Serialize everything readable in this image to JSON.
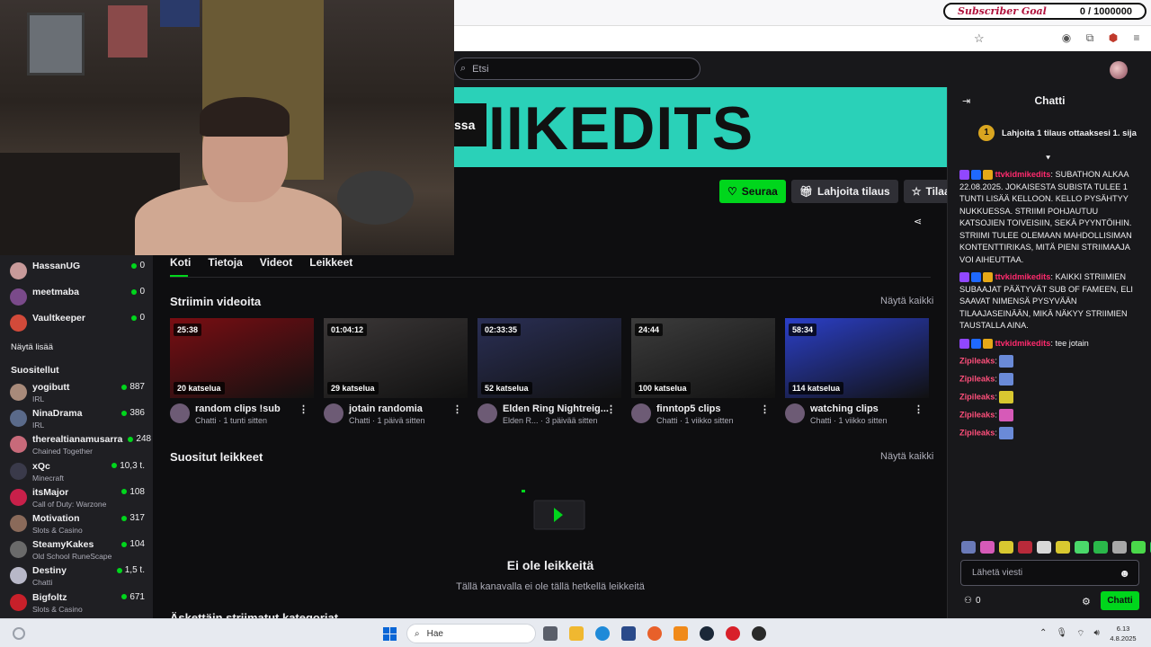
{
  "overlay": {
    "subscriber_goal_label": "Subscriber Goal",
    "subscriber_goal_value": "0 / 1000000"
  },
  "topbar": {
    "search_placeholder": "Etsi"
  },
  "banner": {
    "tag_text": "ssa",
    "word": "IIKEDITS"
  },
  "channel_actions": {
    "follow_label": "Seuraa",
    "gift_label": "Lahjoita tilaus",
    "subscribe_label": "Tilaa"
  },
  "tabs": [
    "Koti",
    "Tietoja",
    "Videot",
    "Leikkeet"
  ],
  "sections": {
    "stream_videos_title": "Striimin videoita",
    "see_all": "Näytä kaikki",
    "popular_clips_title": "Suositut leikkeet",
    "see_all_2": "Näytä kaikki",
    "recent_categories_title": "Äskettäin striimatut kategoriat"
  },
  "videos": [
    {
      "duration": "25:38",
      "views": "20 katselua",
      "title": "random clips !sub",
      "sub": "Chatti · 1 tunti sitten",
      "thumb": "#7a0d12"
    },
    {
      "duration": "01:04:12",
      "views": "29 katselua",
      "title": "jotain randomia",
      "sub": "Chatti · 1 päivä sitten",
      "thumb": "#3b3737"
    },
    {
      "duration": "02:33:35",
      "views": "52 katselua",
      "title": "Elden Ring Nightreig...",
      "sub": "Elden R... · 3 päivää sitten",
      "thumb": "#2a2f55"
    },
    {
      "duration": "24:44",
      "views": "100 katselua",
      "title": "finntop5 clips",
      "sub": "Chatti · 1 viikko sitten",
      "thumb": "#3c3c3c"
    },
    {
      "duration": "58:34",
      "views": "114 katselua",
      "title": "watching clips",
      "sub": "Chatti · 1 viikko sitten",
      "thumb": "#2b3fc8"
    }
  ],
  "clips_empty": {
    "title": "Ei ole leikkeitä",
    "subtitle": "Tällä kanavalla ei ole tällä hetkellä leikkeitä"
  },
  "sidebar": {
    "followed": [
      {
        "name": "HassanUG",
        "count": "0",
        "color": "#c89a9a"
      },
      {
        "name": "meetmaba",
        "count": "0",
        "color": "#7a4a8a"
      },
      {
        "name": "Vaultkeeper",
        "count": "0",
        "color": "#d24a3a"
      }
    ],
    "show_more": "Näytä lisää",
    "recommended_title": "Suositellut",
    "recommended": [
      {
        "name": "yogibutt",
        "game": "IRL",
        "count": "887",
        "color": "#a88a7a"
      },
      {
        "name": "NinaDrama",
        "game": "IRL",
        "count": "386",
        "color": "#5a6a8a"
      },
      {
        "name": "therealtianamusarra",
        "game": "Chained Together",
        "count": "248",
        "color": "#c86a7a"
      },
      {
        "name": "xQc",
        "game": "Minecraft",
        "count": "10,3 t.",
        "color": "#3a3a4a"
      },
      {
        "name": "itsMajor",
        "game": "Call of Duty: Warzone",
        "count": "108",
        "color": "#c8204a"
      },
      {
        "name": "Motivation",
        "game": "Slots & Casino",
        "count": "317",
        "color": "#8a6a5a"
      },
      {
        "name": "SteamyKakes",
        "game": "Old School RuneScape",
        "count": "104",
        "color": "#6a6a6a"
      },
      {
        "name": "Destiny",
        "game": "Chatti",
        "count": "1,5 t.",
        "color": "#b8b8c8"
      },
      {
        "name": "Bigfoltz",
        "game": "Slots & Casino",
        "count": "671",
        "color": "#c8202a"
      }
    ]
  },
  "chat": {
    "title": "Chatti",
    "promo_badge": "1",
    "promo": "Lahjoita 1 tilaus ottaaksesi 1. sija",
    "messages": [
      {
        "user": "ttvkidmikedits",
        "text": "SUBATHON ALKAA 22.08.2025. JOKAISESTA SUBISTA TULEE 1 TUNTI LISÄÄ KELLOON. KELLO PYSÄHTYY NUKKUESSA. STRIIMI POHJAUTUU KATSOJIEN TOIVEISIIN, SEKÄ PYYNTÖIHIN. STRIIMI TULEE OLEMAAN MAHDOLLISIMAN KONTENTTIRIKAS, MITÄ PIENI STRIIMAAJA VOI AIHEUTTAA."
      },
      {
        "user": "ttvkidmikedits",
        "text": "KAIKKI STRIIMIEN SUBAAJAT PÄÄTYVÄT SUB OF FAMEEN, ELI SAAVAT NIMENSÄ PYSYVÄÄN TILAAJASEINÄÄN, MIKÄ NÄKYY STRIIMIEN TAUSTALLA AINA."
      },
      {
        "user": "ttvkidmikedits",
        "text": "tee jotain"
      }
    ],
    "emote_user": "Zipileaks",
    "emote_count": 5,
    "input_placeholder": "Lähetä viesti",
    "points": "0",
    "send_label": "Chatti"
  },
  "taskbar": {
    "search_placeholder": "Hae",
    "time": "6.13",
    "date": "4.8.2025"
  }
}
